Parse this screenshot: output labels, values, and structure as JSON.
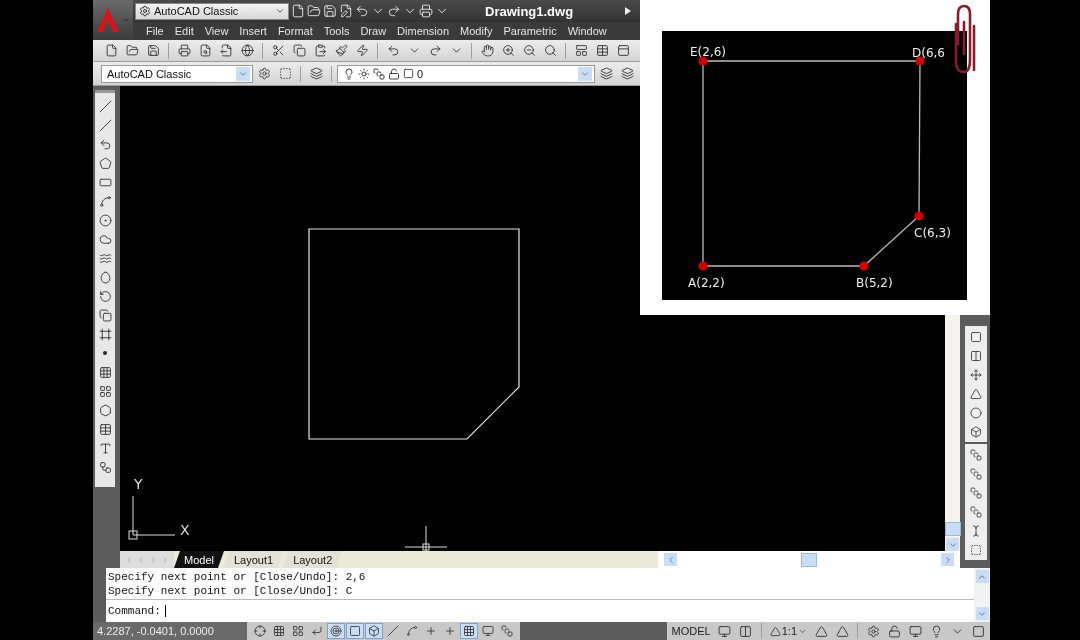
{
  "title_bar": {
    "workspace": "AutoCAD Classic",
    "document_title": "Drawing1.dwg"
  },
  "menu_bar": {
    "items": [
      "File",
      "Edit",
      "View",
      "Insert",
      "Format",
      "Tools",
      "Draw",
      "Dimension",
      "Modify",
      "Parametric",
      "Window"
    ]
  },
  "workspaces_toolbar": {
    "workspace": "AutoCAD Classic"
  },
  "layers_toolbar": {
    "current_layer": "0"
  },
  "canvas": {
    "y_axis_label": "Y",
    "x_axis_label": "X"
  },
  "layout_tabs": [
    {
      "label": "Model",
      "selected": true
    },
    {
      "label": "Layout1",
      "selected": false
    },
    {
      "label": "Layout2",
      "selected": false
    }
  ],
  "command_line": {
    "history": [
      "Specify next point or [Close/Undo]: 2,6",
      "Specify next point or [Close/Undo]: C"
    ],
    "prompt": "Command:"
  },
  "status_bar": {
    "coordinates": "4.2287, -0.0401, 0.0000",
    "toggles": [
      {
        "on": false
      },
      {
        "on": false
      },
      {
        "on": false
      },
      {
        "on": false
      },
      {
        "on": true
      },
      {
        "on": true
      },
      {
        "on": true
      },
      {
        "on": false
      },
      {
        "on": false
      },
      {
        "on": false
      },
      {
        "on": false
      },
      {
        "on": true
      },
      {
        "on": false
      },
      {
        "on": false
      }
    ],
    "space": "MODEL",
    "annotation_scale": "1:1"
  },
  "inset": {
    "points": [
      {
        "label": "A(2,2)"
      },
      {
        "label": "B(5,2)"
      },
      {
        "label": "C(6,3)"
      },
      {
        "label": "D(6,6"
      },
      {
        "label": "E(2,6)"
      }
    ]
  }
}
